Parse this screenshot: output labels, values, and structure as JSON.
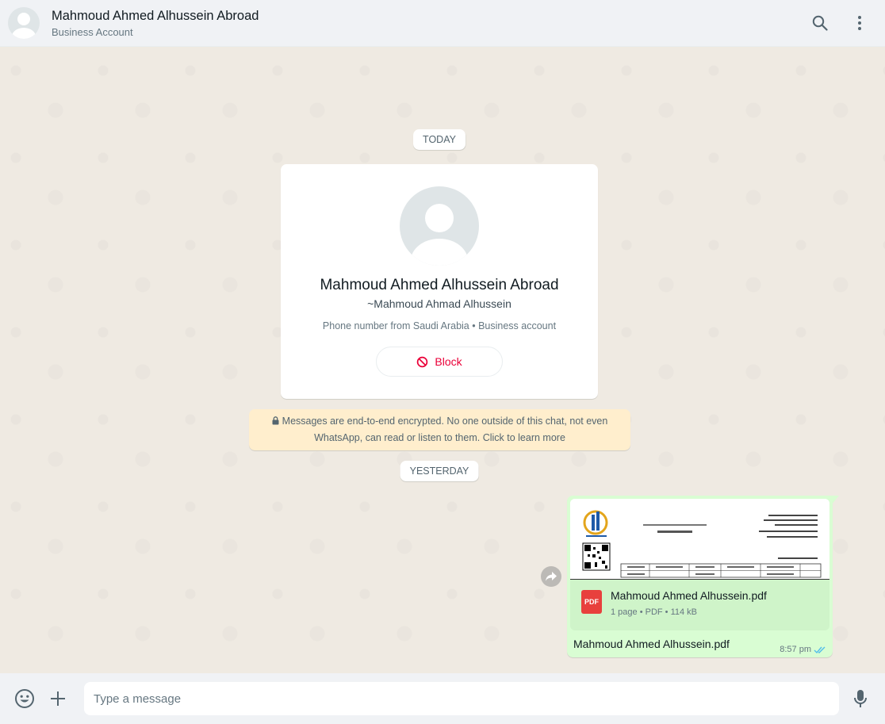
{
  "header": {
    "title": "Mahmoud Ahmed Alhussein Abroad",
    "subtitle": "Business Account"
  },
  "dates": {
    "today": "TODAY",
    "yesterday": "YESTERDAY"
  },
  "profile": {
    "name": "Mahmoud Ahmed Alhussein Abroad",
    "alias": "~Mahmoud Ahmad Alhussein",
    "info": "Phone number from Saudi Arabia • Business account",
    "block_label": "Block"
  },
  "encryption_notice": "Messages are end-to-end encrypted. No one outside of this chat, not even WhatsApp, can read or listen to them. Click to learn more",
  "message": {
    "doc_name": "Mahmoud Ahmed Alhussein.pdf",
    "doc_meta": "1 page • PDF • 114 kB",
    "doc_badge": "PDF",
    "caption": "Mahmoud Ahmed Alhussein.pdf",
    "time": "8:57 pm"
  },
  "composer": {
    "placeholder": "Type a message"
  },
  "colors": {
    "accent": "#53bdeb",
    "danger": "#ea0038",
    "outgoing_bubble": "#d9fdd3",
    "encryption_bg": "#ffeecd"
  },
  "icons": [
    "search-icon",
    "menu-icon",
    "block-icon",
    "lock-icon",
    "forward-icon",
    "pdf-icon",
    "double-check-icon",
    "emoji-icon",
    "plus-icon",
    "mic-icon"
  ]
}
